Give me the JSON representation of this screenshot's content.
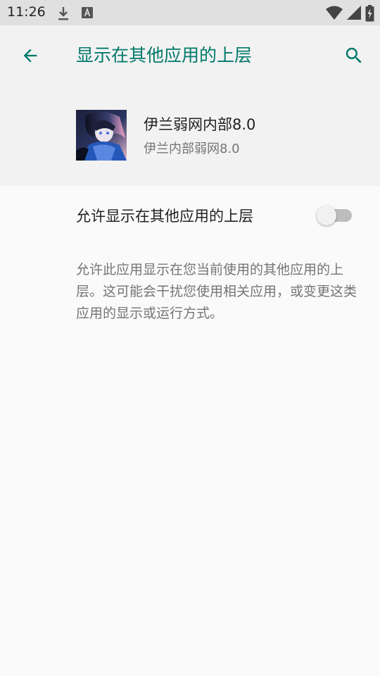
{
  "status_bar": {
    "time": "11:26",
    "icons_left": [
      "download-icon",
      "a-notification-icon"
    ],
    "icons_right": [
      "wifi-icon",
      "signal-icon",
      "battery-charging-icon"
    ]
  },
  "toolbar": {
    "title": "显示在其他应用的上层",
    "back_icon": "arrow-back-icon",
    "search_icon": "search-icon",
    "accent_color": "#00796b"
  },
  "app": {
    "name": "伊兰弱网内部8.0",
    "package": "伊兰内部弱网8.0"
  },
  "setting": {
    "label": "允许显示在其他应用的上层",
    "enabled": false
  },
  "description": "允许此应用显示在您当前使用的其他应用的上层。这可能会干扰您使用相关应用，或变更这类应用的显示或运行方式。"
}
